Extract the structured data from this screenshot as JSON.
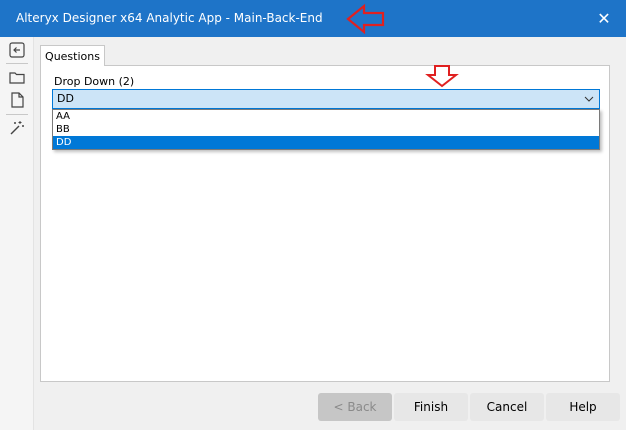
{
  "window": {
    "title": "Alteryx Designer x64 Analytic App - Main-Back-End",
    "close_glyph": "✕"
  },
  "sidebar": {
    "icons": [
      "back-arrow-icon",
      "folder-icon",
      "document-icon",
      "magic-wand-icon"
    ]
  },
  "tabs": [
    {
      "label": "Questions"
    }
  ],
  "question": {
    "label": "Drop Down (2)",
    "selected_value": "DD",
    "options": [
      "AA",
      "BB",
      "DD"
    ],
    "highlighted_option": "DD"
  },
  "footer": {
    "back_label": "< Back",
    "finish_label": "Finish",
    "cancel_label": "Cancel",
    "help_label": "Help"
  },
  "colors": {
    "titlebar": "#1e74c8",
    "accent": "#0078d7",
    "annotation_arrow": "#e02020"
  }
}
